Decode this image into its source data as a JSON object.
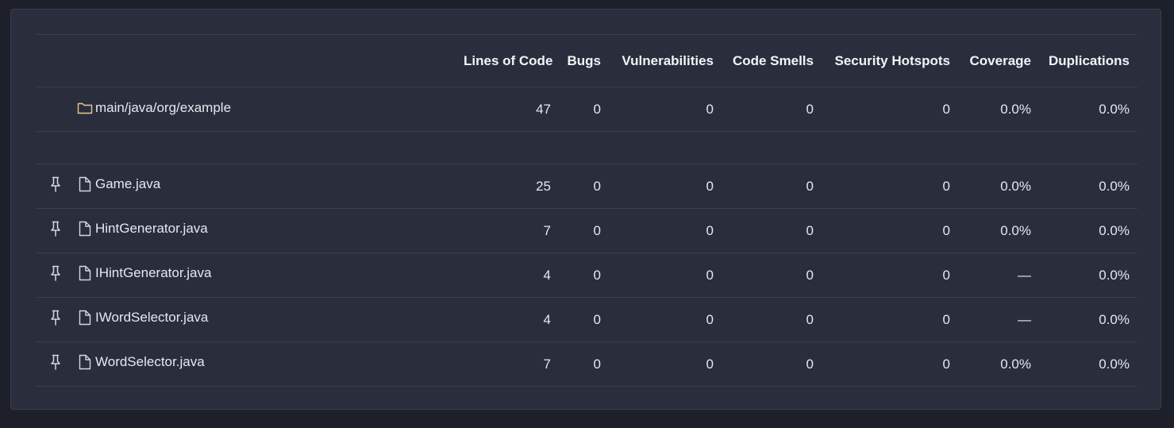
{
  "columns": {
    "loc": "Lines of Code",
    "bugs": "Bugs",
    "vulnerabilities": "Vulnerabilities",
    "code_smells": "Code Smells",
    "security_hotspots": "Security Hotspots",
    "coverage": "Coverage",
    "duplications": "Duplications"
  },
  "directory": {
    "icon": "folder-icon",
    "name": "main/java/org/example",
    "loc": "47",
    "bugs": "0",
    "vulnerabilities": "0",
    "code_smells": "0",
    "security_hotspots": "0",
    "coverage": "0.0%",
    "duplications": "0.0%"
  },
  "files": [
    {
      "pin_icon": "pin-icon",
      "icon": "file-icon",
      "name": "Game.java",
      "loc": "25",
      "bugs": "0",
      "vulnerabilities": "0",
      "code_smells": "0",
      "security_hotspots": "0",
      "coverage": "0.0%",
      "duplications": "0.0%"
    },
    {
      "pin_icon": "pin-icon",
      "icon": "file-icon",
      "name": "HintGenerator.java",
      "loc": "7",
      "bugs": "0",
      "vulnerabilities": "0",
      "code_smells": "0",
      "security_hotspots": "0",
      "coverage": "0.0%",
      "duplications": "0.0%"
    },
    {
      "pin_icon": "pin-icon",
      "icon": "file-icon",
      "name": "IHintGenerator.java",
      "loc": "4",
      "bugs": "0",
      "vulnerabilities": "0",
      "code_smells": "0",
      "security_hotspots": "0",
      "coverage": "—",
      "duplications": "0.0%"
    },
    {
      "pin_icon": "pin-icon",
      "icon": "file-icon",
      "name": "IWordSelector.java",
      "loc": "4",
      "bugs": "0",
      "vulnerabilities": "0",
      "code_smells": "0",
      "security_hotspots": "0",
      "coverage": "—",
      "duplications": "0.0%"
    },
    {
      "pin_icon": "pin-icon",
      "icon": "file-icon",
      "name": "WordSelector.java",
      "loc": "7",
      "bugs": "0",
      "vulnerabilities": "0",
      "code_smells": "0",
      "security_hotspots": "0",
      "coverage": "0.0%",
      "duplications": "0.0%"
    }
  ],
  "colors": {
    "background": "#1d1f2b",
    "card": "#2a2e3c",
    "border": "#3a3e4d",
    "text": "#e6e8ef",
    "folder_icon": "#e8c78c",
    "icon": "#d5d8e2"
  }
}
